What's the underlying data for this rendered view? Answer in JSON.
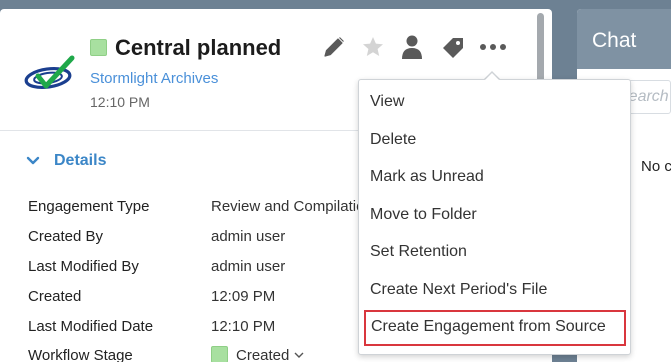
{
  "record": {
    "title": "Central planned",
    "client": "Stormlight Archives",
    "time": "12:10 PM",
    "status_color": "#a8e0a0"
  },
  "header_icons": [
    "edit-icon",
    "star-icon",
    "user-icon",
    "tag-icon",
    "more-icon"
  ],
  "details": {
    "label": "Details",
    "rows": [
      {
        "label": "Engagement Type",
        "value": "Review and Compilation"
      },
      {
        "label": "Created By",
        "value": "admin user"
      },
      {
        "label": "Last Modified By",
        "value": "admin user"
      },
      {
        "label": "Created",
        "value": "12:09 PM"
      },
      {
        "label": "Last Modified Date",
        "value": "12:10 PM"
      },
      {
        "label": "Workflow Stage",
        "value": "Created"
      }
    ]
  },
  "menu": {
    "items": [
      "View",
      "Delete",
      "Mark as Unread",
      "Move to Folder",
      "Set Retention",
      "Create Next Period's File",
      "Create Engagement from Source"
    ],
    "highlight_color": "#d9363e"
  },
  "chat": {
    "title": "Chat",
    "search_placeholder": "Search",
    "empty_text": "No chats"
  }
}
